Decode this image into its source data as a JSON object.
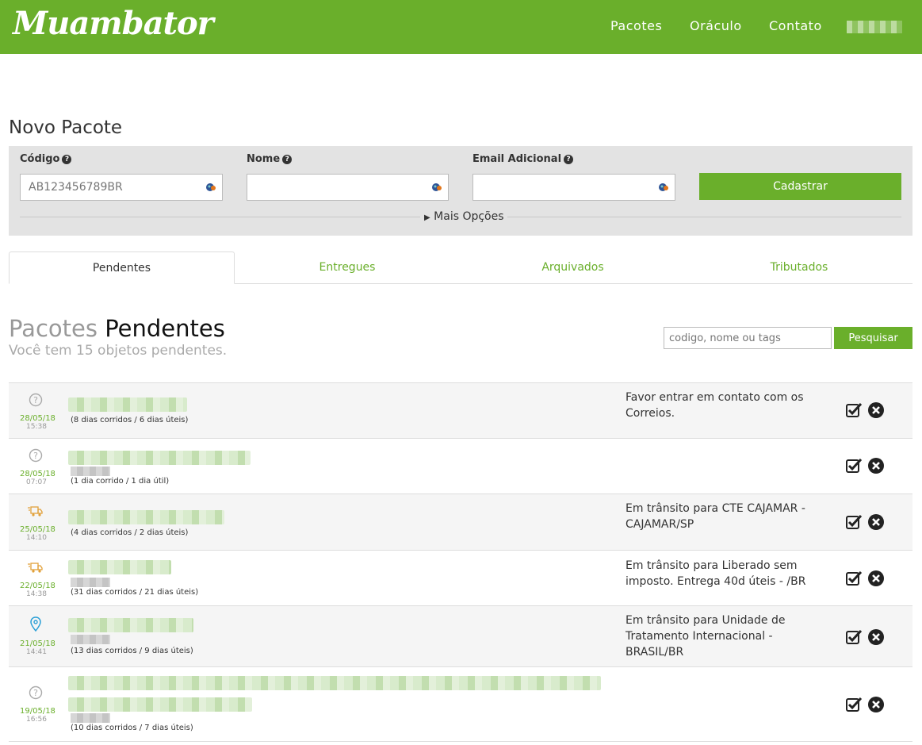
{
  "header": {
    "logo": "Muambator",
    "nav": [
      "Pacotes",
      "Oráculo",
      "Contato"
    ],
    "brand_color": "#6aaf2b"
  },
  "novo_pacote": {
    "title": "Novo Pacote",
    "codigo_label": "Código",
    "codigo_placeholder": "AB123456789BR",
    "nome_label": "Nome",
    "email_label": "Email Adicional",
    "submit": "Cadastrar",
    "more_options": "Mais Opções"
  },
  "tabs": [
    "Pendentes",
    "Entregues",
    "Arquivados",
    "Tributados"
  ],
  "pendentes": {
    "title_light": "Pacotes",
    "title_dark": "Pendentes",
    "subtitle": "Você tem 15 objetos pendentes.",
    "search_placeholder": "codigo, nome ou tags",
    "search_button": "Pesquisar"
  },
  "packages": [
    {
      "icon": "question-icon",
      "date": "28/05/18",
      "time": "15:38",
      "days": "(8 dias corridos / 6 dias úteis)",
      "status": "Favor entrar em contato com os Correios."
    },
    {
      "icon": "question-icon",
      "date": "28/05/18",
      "time": "07:07",
      "days": "(1 dia corrido / 1 dia útil)",
      "status": ""
    },
    {
      "icon": "truck-icon",
      "date": "25/05/18",
      "time": "14:10",
      "days": "(4 dias corridos / 2 dias úteis)",
      "status": "Em trânsito para CTE CAJAMAR - CAJAMAR/SP"
    },
    {
      "icon": "truck-icon",
      "date": "22/05/18",
      "time": "14:38",
      "days": "(31 dias corridos / 21 dias úteis)",
      "status": "Em trânsito para Liberado sem imposto. Entrega 40d úteis - /BR"
    },
    {
      "icon": "location-icon",
      "date": "21/05/18",
      "time": "14:41",
      "days": "(13 dias corridos / 9 dias úteis)",
      "status": "Em trânsito para Unidade de Tratamento Internacional - BRASIL/BR"
    },
    {
      "icon": "question-icon",
      "date": "19/05/18",
      "time": "16:56",
      "days": "(10 dias corridos / 7 dias úteis)",
      "status": ""
    }
  ]
}
